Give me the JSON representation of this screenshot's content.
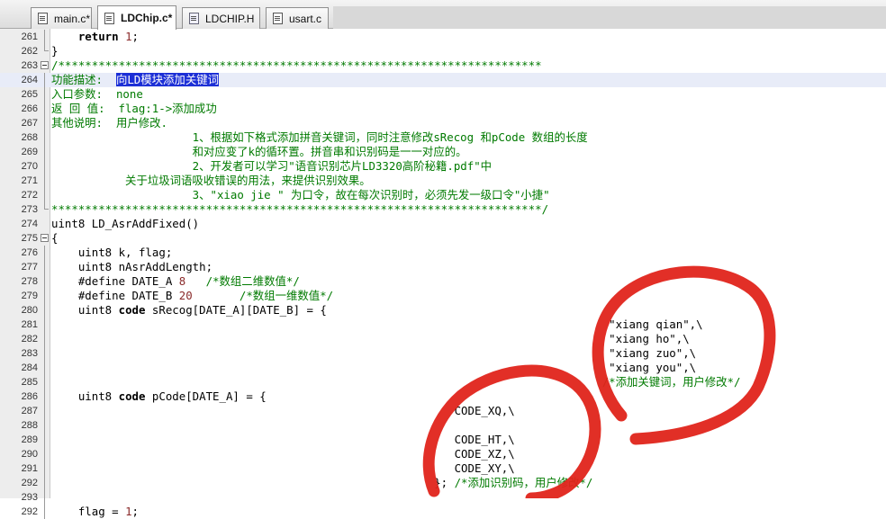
{
  "tabs": [
    {
      "label": "main.c*",
      "active": false,
      "icon": "c-file-icon"
    },
    {
      "label": "LDChip.c*",
      "active": true,
      "icon": "c-file-icon"
    },
    {
      "label": "LDCHIP.H",
      "active": false,
      "icon": "h-file-icon"
    },
    {
      "label": "usart.c",
      "active": false,
      "icon": "c-file-icon"
    }
  ],
  "colors": {
    "comment": "#007a00",
    "selection": "#1c2fd6",
    "annotation": "#e0241b",
    "gutter": "#ededed"
  },
  "editor": {
    "lines": [
      {
        "n": "261",
        "fold": "line",
        "segs": [
          {
            "t": "    ",
            "c": "plain"
          },
          {
            "t": "return",
            "c": "kw"
          },
          {
            "t": " ",
            "c": "plain"
          },
          {
            "t": "1",
            "c": "num"
          },
          {
            "t": ";",
            "c": "plain"
          }
        ]
      },
      {
        "n": "262",
        "fold": "end",
        "segs": [
          {
            "t": "}",
            "c": "plain"
          }
        ]
      },
      {
        "n": "263",
        "fold": "box",
        "segs": [
          {
            "t": "/************************************************************************",
            "c": "cmt"
          }
        ]
      },
      {
        "n": "264",
        "fold": "line",
        "current": true,
        "segs": [
          {
            "t": "功能描述:  ",
            "c": "cmt"
          },
          {
            "t": "向LD模块添加关键词",
            "c": "sel"
          }
        ]
      },
      {
        "n": "265",
        "fold": "line",
        "segs": [
          {
            "t": "入口参数:  none",
            "c": "cmt"
          }
        ]
      },
      {
        "n": "266",
        "fold": "line",
        "segs": [
          {
            "t": "返 回 值:  flag:1->添加成功",
            "c": "cmt"
          }
        ]
      },
      {
        "n": "267",
        "fold": "line",
        "segs": [
          {
            "t": "其他说明:  用户修改.",
            "c": "cmt"
          }
        ]
      },
      {
        "n": "268",
        "fold": "line",
        "segs": [
          {
            "t": "                     1、根据如下格式添加拼音关键词，同时注意修改sRecog 和pCode 数组的长度",
            "c": "cmt"
          }
        ]
      },
      {
        "n": "269",
        "fold": "line",
        "segs": [
          {
            "t": "                     和对应变了k的循环置。拼音串和识别码是一一对应的。",
            "c": "cmt"
          }
        ]
      },
      {
        "n": "270",
        "fold": "line",
        "segs": [
          {
            "t": "                     2、开发者可以学习\"语音识别芯片LD3320高阶秘籍.pdf\"中",
            "c": "cmt"
          }
        ]
      },
      {
        "n": "271",
        "fold": "line",
        "segs": [
          {
            "t": "           关于垃圾词语吸收错误的用法，来提供识别效果。",
            "c": "cmt"
          }
        ]
      },
      {
        "n": "272",
        "fold": "line",
        "segs": [
          {
            "t": "                     3、\"xiao jie \" 为口令，故在每次识别时，必须先发一级口令\"小捷\"",
            "c": "cmt"
          }
        ]
      },
      {
        "n": "273",
        "fold": "end",
        "segs": [
          {
            "t": "*************************************************************************/",
            "c": "cmt"
          }
        ]
      },
      {
        "n": "274",
        "fold": "",
        "segs": [
          {
            "t": "uint8 LD_AsrAddFixed()",
            "c": "plain"
          }
        ]
      },
      {
        "n": "275",
        "fold": "box",
        "segs": [
          {
            "t": "{",
            "c": "plain"
          }
        ]
      },
      {
        "n": "276",
        "fold": "line",
        "segs": [
          {
            "t": "    uint8 k, flag;",
            "c": "plain"
          }
        ]
      },
      {
        "n": "277",
        "fold": "line",
        "segs": [
          {
            "t": "    uint8 nAsrAddLength;",
            "c": "plain"
          }
        ]
      },
      {
        "n": "278",
        "fold": "line",
        "segs": [
          {
            "t": "    #define DATE_A ",
            "c": "plain"
          },
          {
            "t": "8",
            "c": "num"
          },
          {
            "t": "   ",
            "c": "plain"
          },
          {
            "t": "/*数组二维数值*/",
            "c": "cmt"
          }
        ]
      },
      {
        "n": "279",
        "fold": "line",
        "segs": [
          {
            "t": "    #define DATE_B ",
            "c": "plain"
          },
          {
            "t": "20",
            "c": "num"
          },
          {
            "t": "       ",
            "c": "plain"
          },
          {
            "t": "/*数组一维数值*/",
            "c": "cmt"
          }
        ]
      },
      {
        "n": "280",
        "fold": "line",
        "segs": [
          {
            "t": "    uint8 ",
            "c": "plain"
          },
          {
            "t": "code",
            "c": "kw"
          },
          {
            "t": " sRecog[DATE_A][DATE_B] = {",
            "c": "plain"
          }
        ]
      },
      {
        "n": "281",
        "fold": "line",
        "segs": [
          {
            "t": "                                                                                   \"xiang qian\",\\",
            "c": "plain"
          }
        ]
      },
      {
        "n": "282",
        "fold": "line",
        "segs": [
          {
            "t": "                                                                                   \"xiang ho\",\\",
            "c": "plain"
          }
        ]
      },
      {
        "n": "283",
        "fold": "line",
        "segs": [
          {
            "t": "                                                                                   \"xiang zuo\",\\",
            "c": "plain"
          }
        ]
      },
      {
        "n": "284",
        "fold": "line",
        "segs": [
          {
            "t": "                                                                                   \"xiang you\",\\",
            "c": "plain"
          }
        ]
      },
      {
        "n": "285",
        "fold": "line",
        "segs": [
          {
            "t": "                                                                                  ",
            "c": "plain"
          },
          {
            "t": "/*添加关键词，用户修改*/",
            "c": "cmt"
          }
        ]
      },
      {
        "n": "286",
        "fold": "line",
        "segs": [
          {
            "t": "    uint8 ",
            "c": "plain"
          },
          {
            "t": "code",
            "c": "kw"
          },
          {
            "t": " pCode[DATE_A] = {",
            "c": "plain"
          }
        ]
      },
      {
        "n": "287",
        "fold": "line",
        "segs": [
          {
            "t": "                                                            CODE_XQ,\\",
            "c": "plain"
          }
        ]
      },
      {
        "n": "288",
        "fold": "line",
        "segs": [
          {
            "t": "",
            "c": "plain"
          }
        ]
      },
      {
        "n": "289",
        "fold": "line",
        "segs": [
          {
            "t": "                                                            CODE_HT,\\",
            "c": "plain"
          }
        ]
      },
      {
        "n": "290",
        "fold": "line",
        "segs": [
          {
            "t": "                                                            CODE_XZ,\\",
            "c": "plain"
          }
        ]
      },
      {
        "n": "291",
        "fold": "line",
        "segs": [
          {
            "t": "                                                            CODE_XY,\\",
            "c": "plain"
          }
        ]
      },
      {
        "n": "292",
        "fold": "line",
        "segs": [
          {
            "t": "                                                         }; ",
            "c": "plain"
          },
          {
            "t": "/*添加识别码，用户修改*/",
            "c": "cmt"
          }
        ]
      },
      {
        "n": "293",
        "fold": "line",
        "segs": [
          {
            "t": "",
            "c": "plain"
          }
        ]
      },
      {
        "n": "292",
        "fold": "line",
        "segs": [
          {
            "t": "    flag = ",
            "c": "plain"
          },
          {
            "t": "1",
            "c": "num"
          },
          {
            "t": ";",
            "c": "plain"
          }
        ]
      }
    ]
  }
}
